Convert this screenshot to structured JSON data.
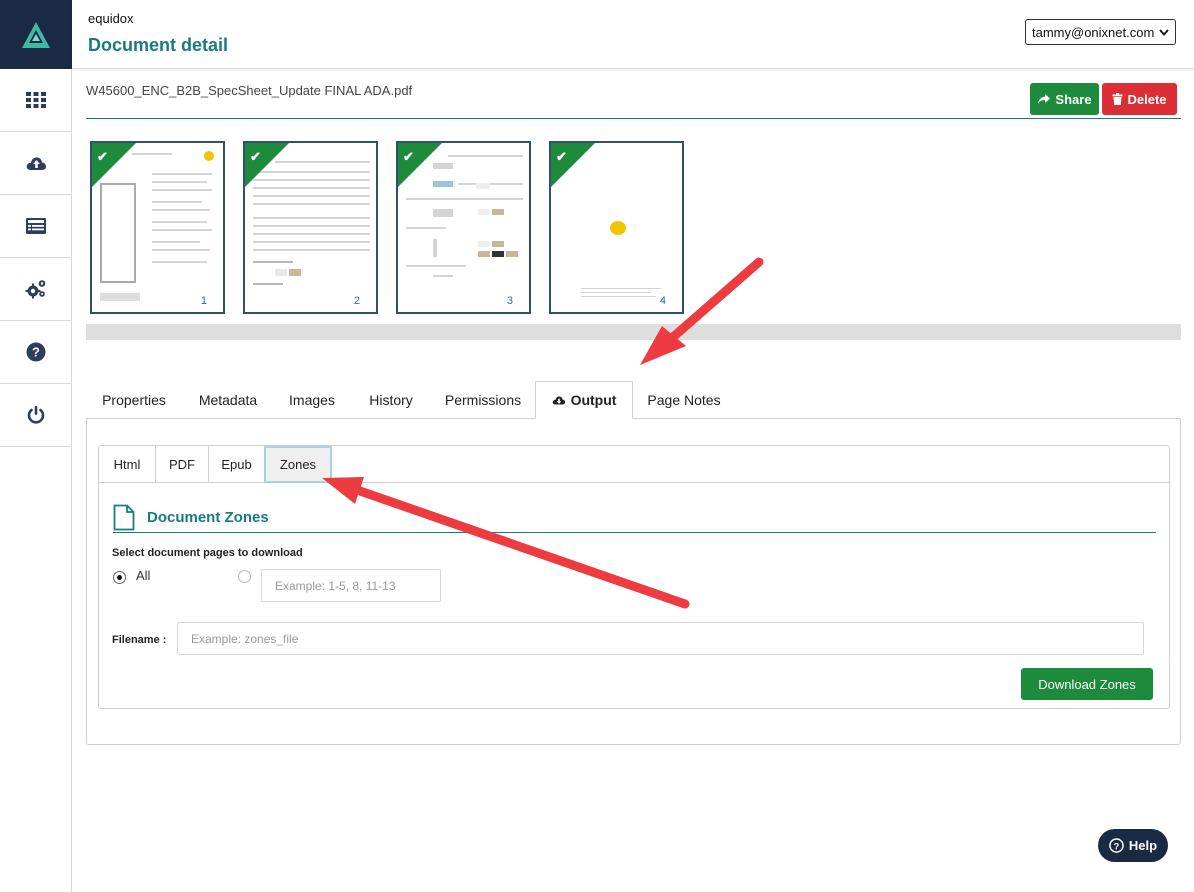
{
  "app": {
    "name": "equidox",
    "page_title": "Document detail"
  },
  "user": {
    "email": "tammy@onixnet.com"
  },
  "sidebar": {
    "items": [
      {
        "name": "apps-grid-icon"
      },
      {
        "name": "cloud-upload-icon"
      },
      {
        "name": "list-icon"
      },
      {
        "name": "gears-icon"
      },
      {
        "name": "help-circle-icon"
      },
      {
        "name": "power-icon"
      }
    ]
  },
  "document": {
    "filename": "W45600_ENC_B2B_SpecSheet_Update FINAL ADA.pdf",
    "share_label": "Share",
    "delete_label": "Delete"
  },
  "thumbnails": [
    {
      "page": "1",
      "status": "complete"
    },
    {
      "page": "2",
      "status": "complete"
    },
    {
      "page": "3",
      "status": "complete"
    },
    {
      "page": "4",
      "status": "complete"
    }
  ],
  "tabs": {
    "items": [
      "Properties",
      "Metadata",
      "Images",
      "History",
      "Permissions",
      "Output",
      "Page Notes"
    ],
    "active": "Output"
  },
  "output": {
    "subtabs": [
      "Html",
      "PDF",
      "Epub",
      "Zones"
    ],
    "active_subtab": "Zones",
    "section_title": "Document Zones",
    "pages_label": "Select document pages to download",
    "all_label": "All",
    "range_placeholder": "Example: 1-5, 8, 11-13",
    "filename_label": "Filename :",
    "filename_placeholder": "Example: zones_file",
    "download_label": "Download Zones"
  },
  "help": {
    "label": "Help"
  },
  "colors": {
    "teal": "#1a7a84",
    "navy": "#1b2a44",
    "green": "#1e8a3c",
    "red": "#dc2e35",
    "arrow": "#ee3b3f"
  }
}
